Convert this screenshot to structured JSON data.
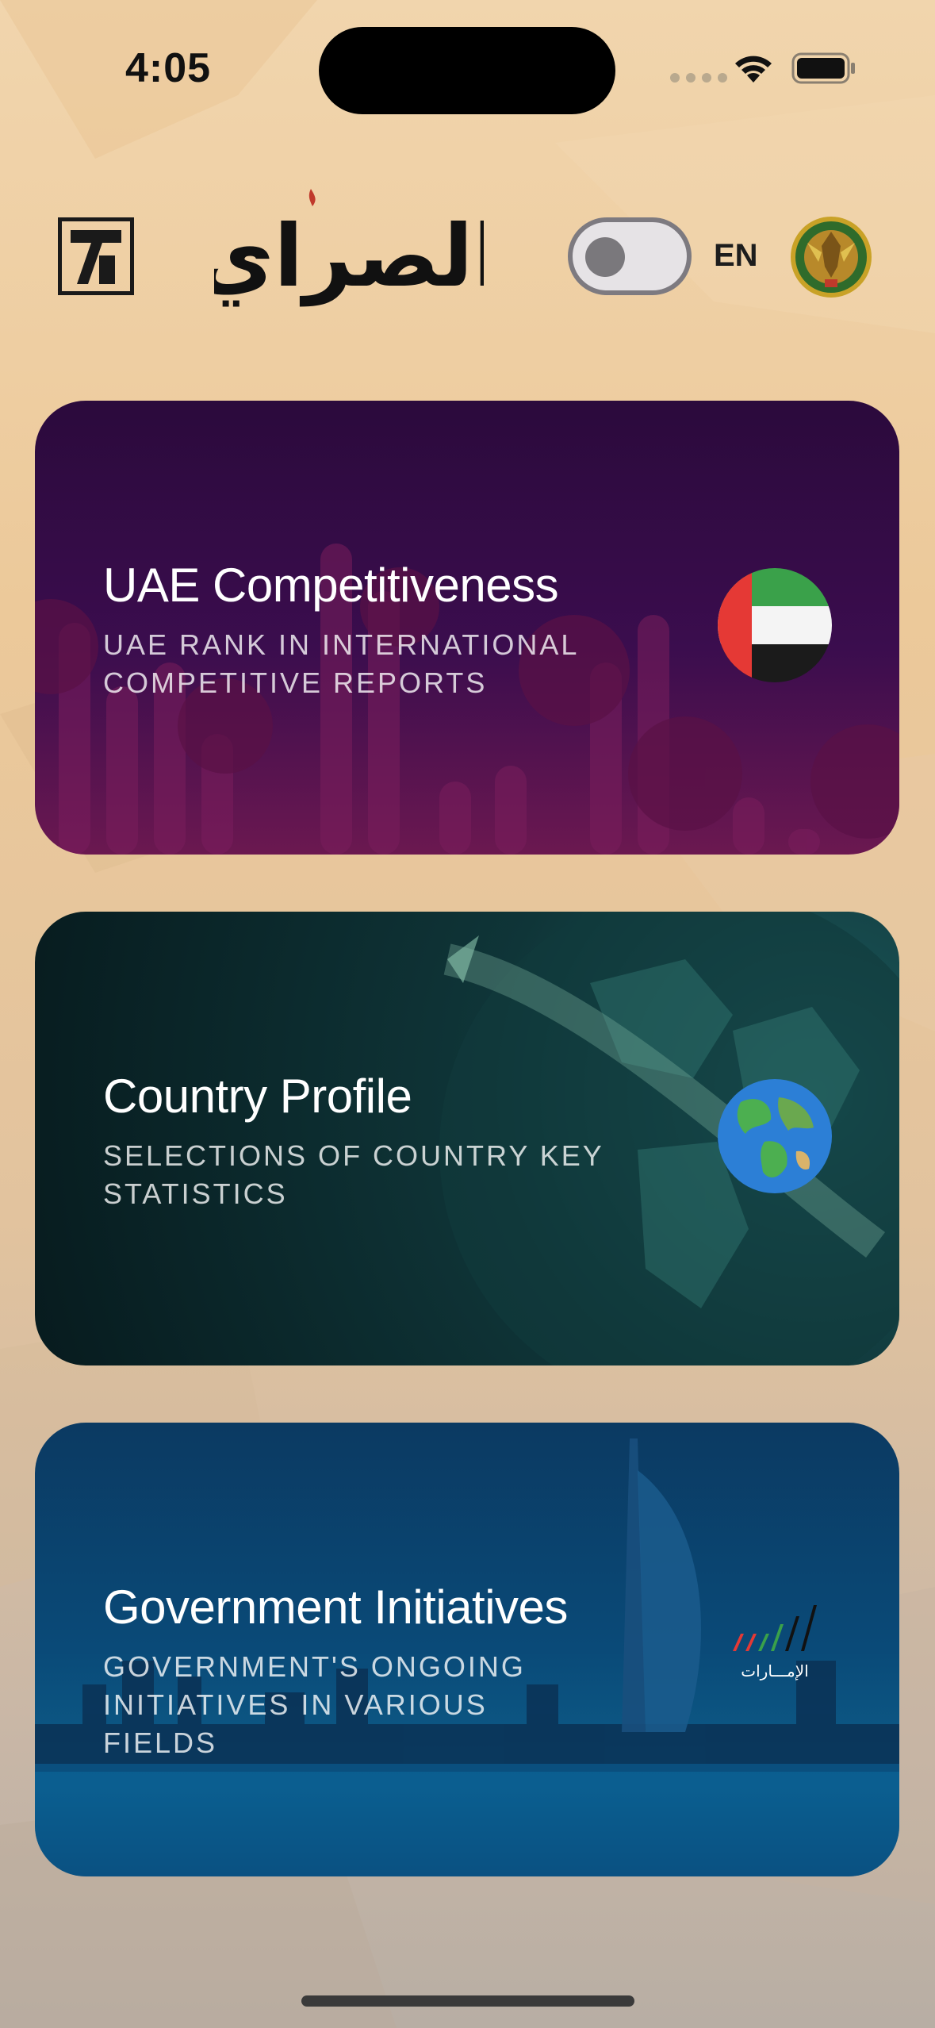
{
  "status_bar": {
    "time": "4:05"
  },
  "header": {
    "brand_text": "الصراي",
    "language": "EN",
    "toggle_on": false
  },
  "cards": [
    {
      "title": "UAE Competitiveness",
      "subtitle": "UAE RANK IN INTERNATIONAL COMPETITIVE REPORTS",
      "icon": "uae-flag-icon"
    },
    {
      "title": "Country Profile",
      "subtitle": "SELECTIONS OF COUNTRY KEY STATISTICS",
      "icon": "globe-icon"
    },
    {
      "title": "Government Initiatives",
      "subtitle": "GOVERNMENT'S ONGOING INITIATIVES IN VARIOUS FIELDS",
      "icon": "uae-brand-icon",
      "icon_text": "الإمـــارات"
    }
  ],
  "colors": {
    "card1": "#3b0d4e",
    "card2": "#0f3538",
    "card3": "#0a4a78",
    "flag_green": "#3aa14a",
    "flag_red": "#e53935"
  }
}
